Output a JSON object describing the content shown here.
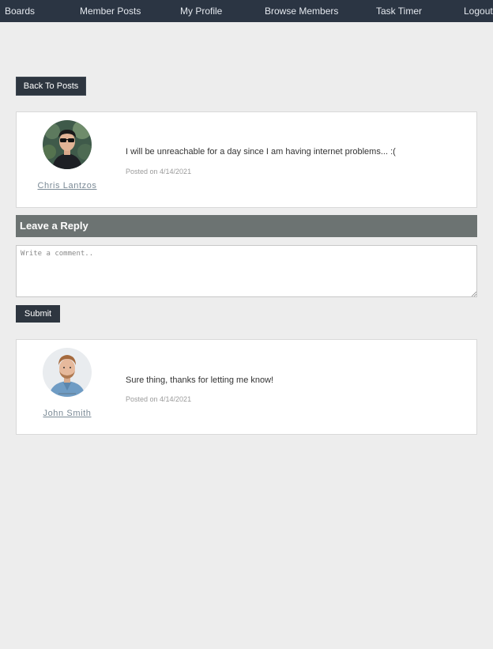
{
  "nav": {
    "items": [
      {
        "label": "Boards"
      },
      {
        "label": "Member Posts"
      },
      {
        "label": "My Profile"
      },
      {
        "label": "Browse Members"
      },
      {
        "label": "Task Timer"
      },
      {
        "label": "Logout"
      }
    ]
  },
  "back_button": {
    "label": "Back To Posts"
  },
  "post": {
    "author": "Chris Lantzos",
    "message": "I will be unreachable for a day since I am having internet problems... :(",
    "posted": "Posted on 4/14/2021"
  },
  "reply_form": {
    "heading": "Leave a Reply",
    "placeholder": "Write a comment..",
    "submit_label": "Submit"
  },
  "replies": [
    {
      "author": "John Smith",
      "message": "Sure thing, thanks for letting me know!",
      "posted": "Posted on 4/14/2021"
    }
  ],
  "colors": {
    "navbar": "#2b3543",
    "button": "#2e3640",
    "reply_bar": "#6c7372",
    "page_bg": "#ededed"
  }
}
